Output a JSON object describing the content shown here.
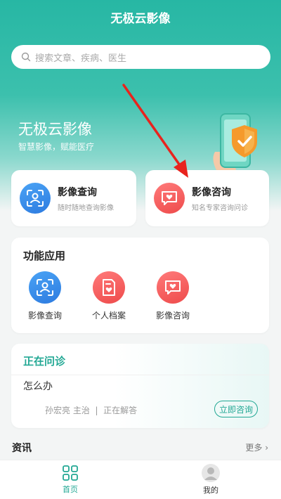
{
  "header": {
    "title": "无极云影像"
  },
  "search": {
    "placeholder": "搜索文章、疾病、医生"
  },
  "banner": {
    "title": "无极云影像",
    "subtitle": "智慧影像，赋能医疗"
  },
  "quick_cards": [
    {
      "title": "影像查询",
      "subtitle": "随时随地查询影像",
      "icon": "scan-user-icon",
      "color": "#3b8ff0"
    },
    {
      "title": "影像咨询",
      "subtitle": "知名专家咨询问诊",
      "icon": "chat-heart-icon",
      "color": "#f05a5a"
    }
  ],
  "functions": {
    "title": "功能应用",
    "items": [
      {
        "label": "影像查询",
        "icon": "scan-user-icon"
      },
      {
        "label": "个人档案",
        "icon": "file-heart-icon"
      },
      {
        "label": "影像咨询",
        "icon": "chat-heart-icon"
      }
    ]
  },
  "consultation": {
    "title": "正在问诊",
    "question": "怎么办",
    "doctor": "孙宏亮 主治  |  正在解答",
    "button": "立即咨询"
  },
  "news": {
    "title": "资讯",
    "more": "更多 ›"
  },
  "tabbar": {
    "items": [
      {
        "label": "首页",
        "icon": "grid-home-icon",
        "active": true
      },
      {
        "label": "我的",
        "icon": "user-avatar-icon",
        "active": false
      }
    ]
  },
  "colors": {
    "brand": "#22a894",
    "accent_blue": "#3b8ff0",
    "accent_red": "#f05a5a"
  }
}
